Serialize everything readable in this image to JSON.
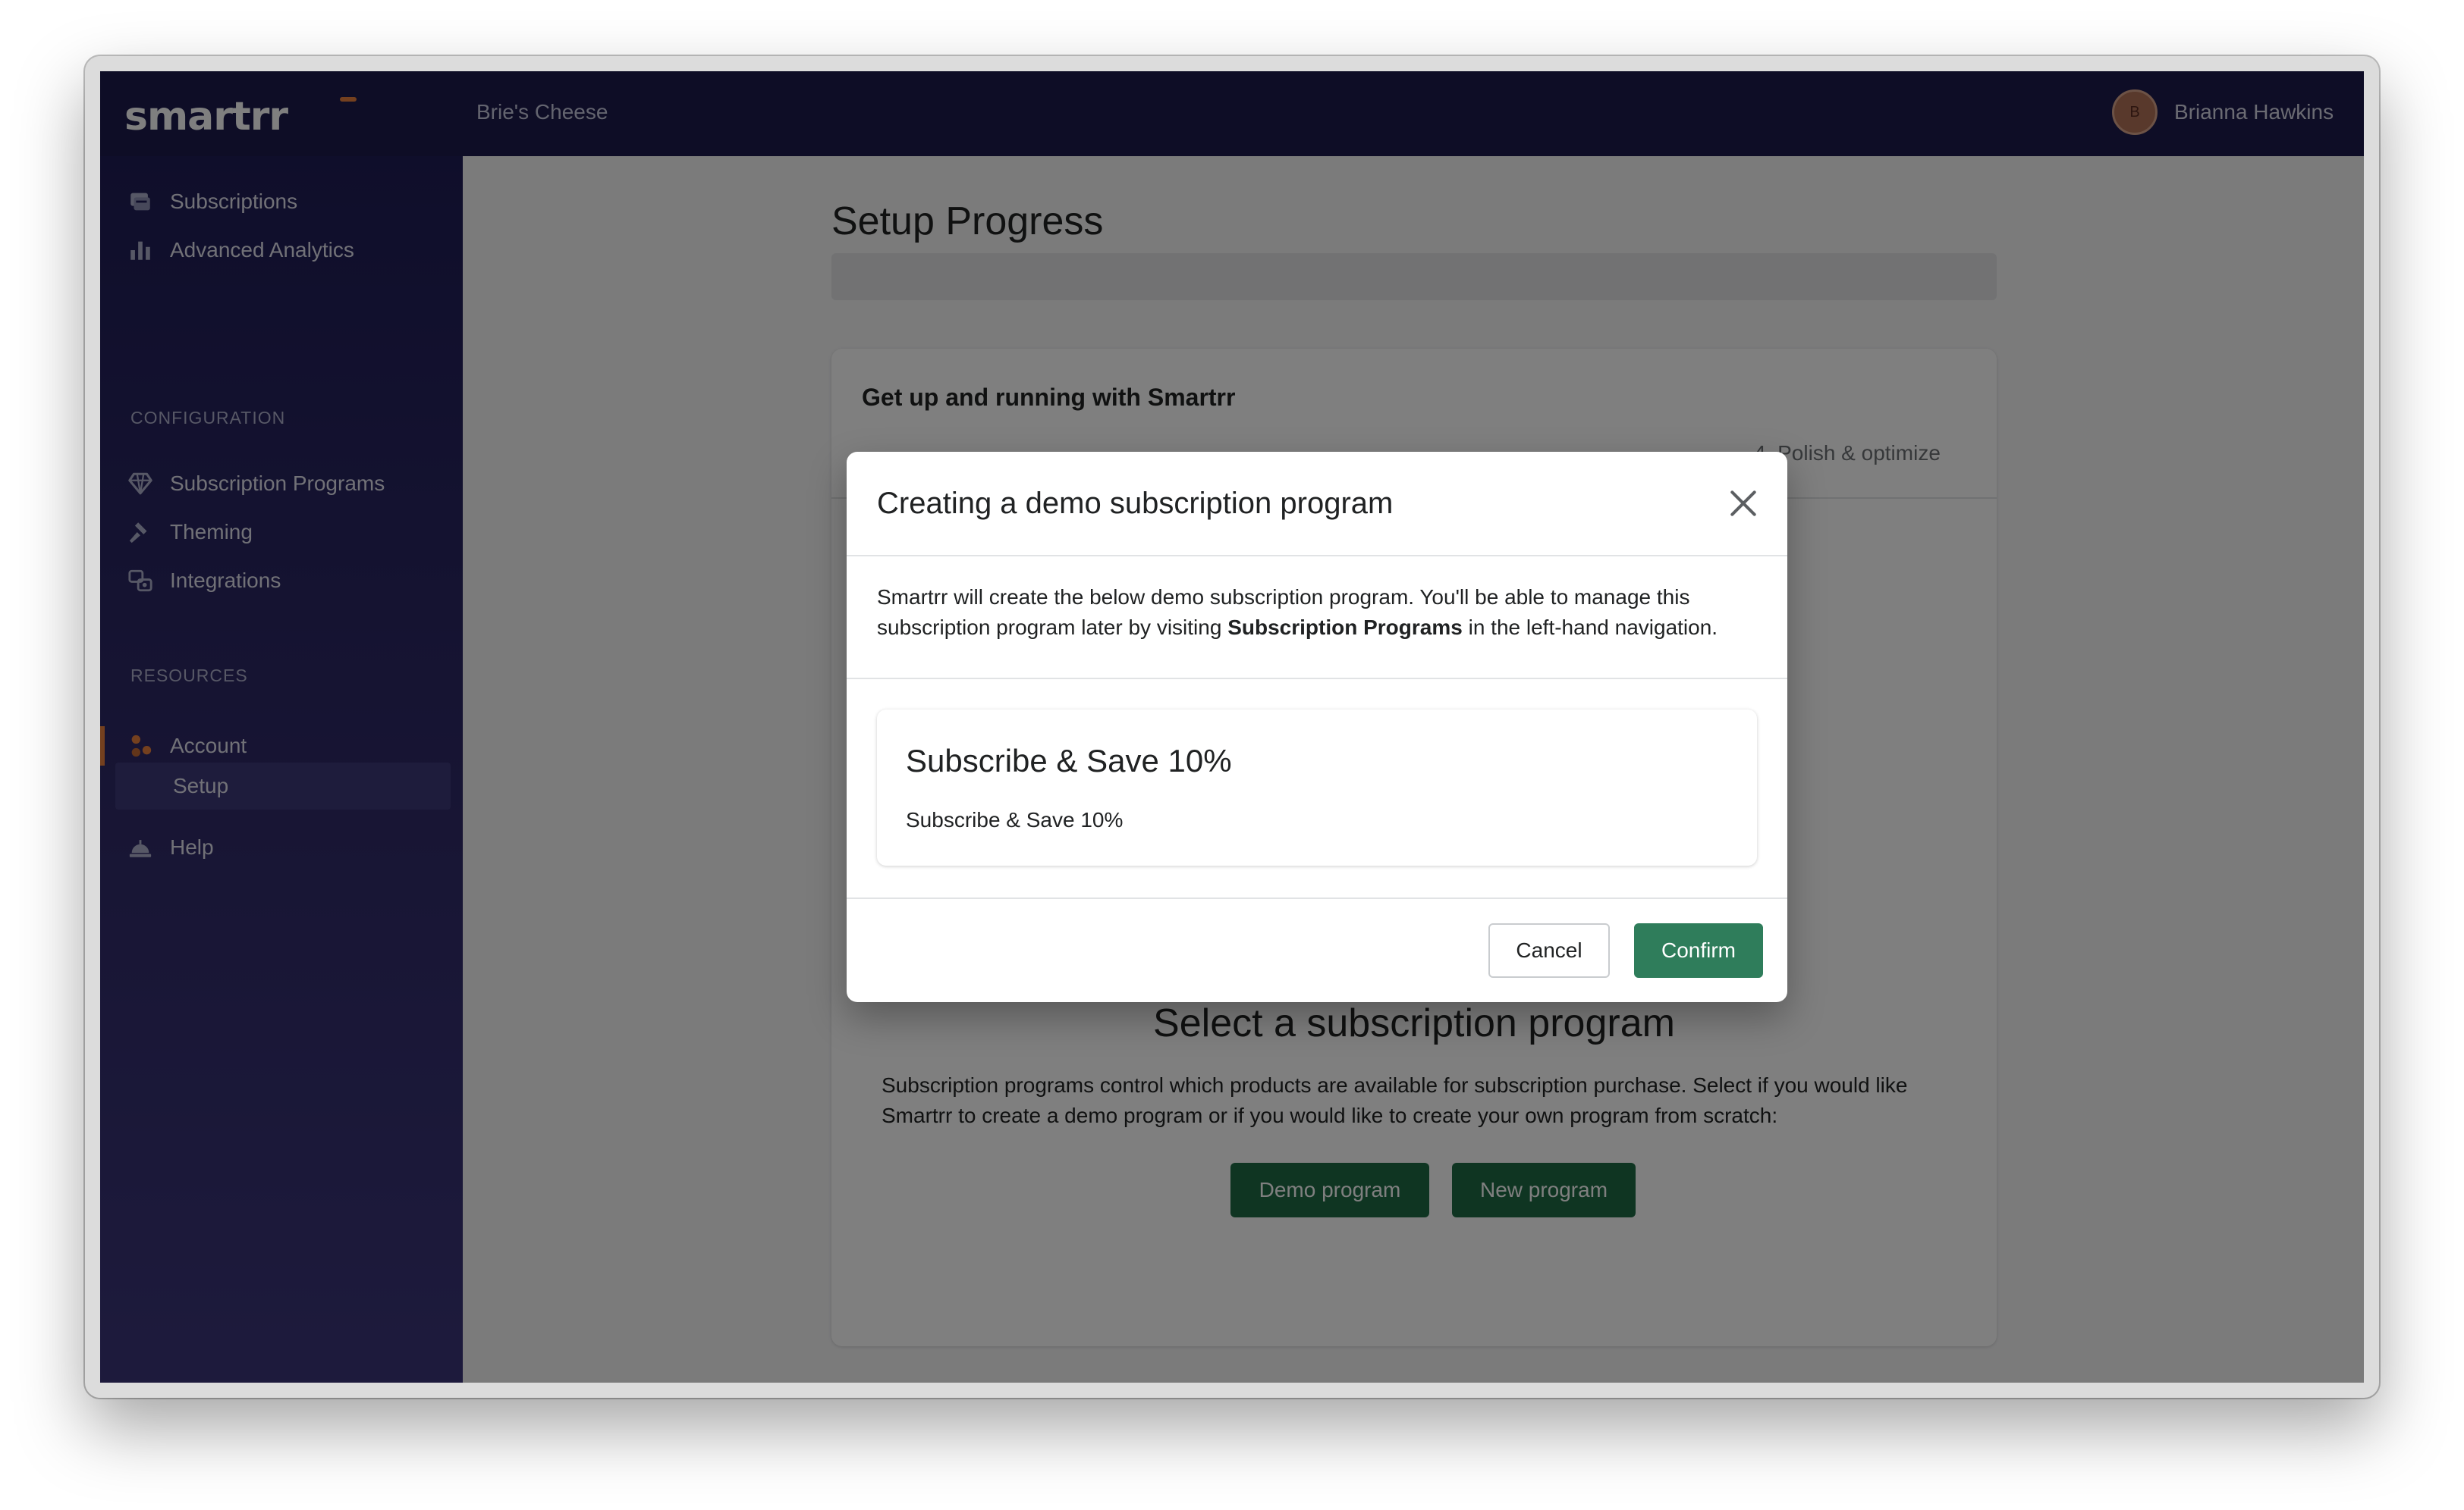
{
  "app": {
    "logo": "smartrr",
    "store_name": "Brie's Cheese",
    "user": {
      "initial": "B",
      "name": "Brianna Hawkins"
    }
  },
  "sidebar": {
    "items": [
      {
        "label": "Subscriptions",
        "icon": "subscriptions-icon"
      },
      {
        "label": "Advanced Analytics",
        "icon": "analytics-bar-chart-icon"
      }
    ],
    "configuration_label": "CONFIGURATION",
    "configuration_items": [
      {
        "label": "Subscription Programs",
        "icon": "diamond-icon"
      },
      {
        "label": "Theming",
        "icon": "hammer-icon"
      },
      {
        "label": "Integrations",
        "icon": "integrations-icon"
      }
    ],
    "resources_label": "RESOURCES",
    "resources_items": [
      {
        "label": "Account",
        "icon": "account-icon"
      },
      {
        "label": "Setup"
      },
      {
        "label": "Help",
        "icon": "help-bell-icon"
      }
    ]
  },
  "main": {
    "page_title": "Setup Progress",
    "card_title": "Get up and running with Smartrr",
    "step_label": "4. Polish & optimize",
    "select_title": "Select a subscription program",
    "select_description": "Subscription programs control which products are available for subscription purchase. Select if you would like Smartrr to create a demo program or if you would like to create your own program from scratch:",
    "demo_button": "Demo program",
    "new_button": "New program"
  },
  "modal": {
    "title": "Creating a demo subscription program",
    "text_before": "Smartrr will create the below demo subscription program. You'll be able to manage this subscription program later by visiting ",
    "text_bold": "Subscription Programs",
    "text_after": " in the left-hand navigation.",
    "program_title": "Subscribe & Save 10%",
    "program_subtitle": "Subscribe & Save 10%",
    "cancel_label": "Cancel",
    "confirm_label": "Confirm"
  },
  "colors": {
    "topbar": "#1c1b4c",
    "accent": "#e9803e",
    "primary_button": "#2f7d5b"
  }
}
